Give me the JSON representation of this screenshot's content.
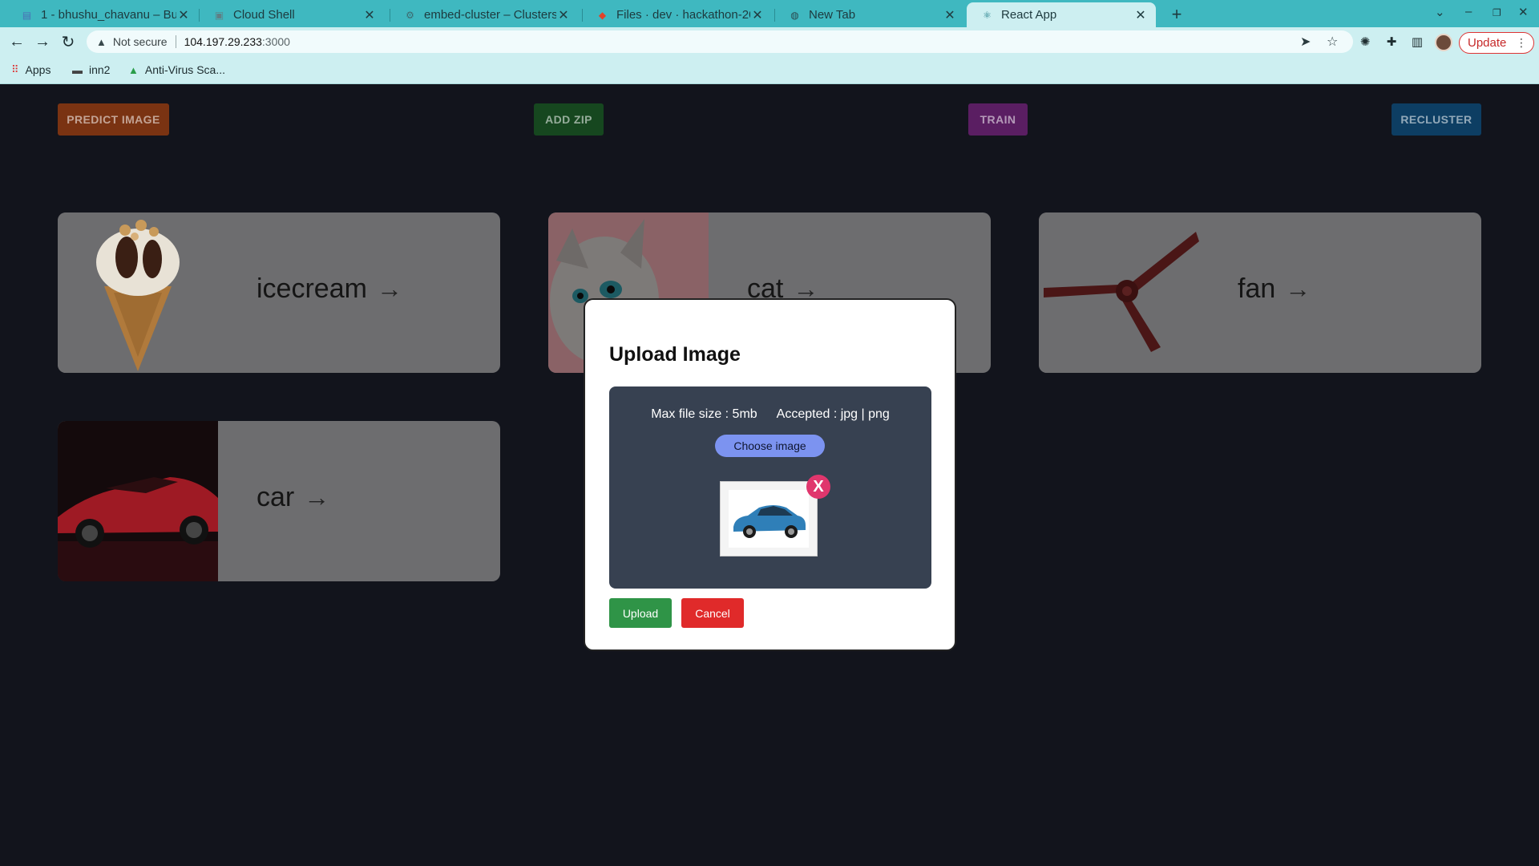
{
  "browser": {
    "tabs": [
      {
        "title": "1 - bhushu_chavanu – Buc",
        "icon": "doc-icon"
      },
      {
        "title": "Cloud Shell",
        "icon": "cloud-icon"
      },
      {
        "title": "embed-cluster – Clusters",
        "icon": "gear-icon"
      },
      {
        "title": "Files · dev · hackathon-20",
        "icon": "gitlab-icon"
      },
      {
        "title": "New Tab",
        "icon": "globe-icon"
      },
      {
        "title": "React App",
        "icon": "react-icon",
        "active": true
      }
    ],
    "address": {
      "security": "Not secure",
      "host": "104.197.29.233",
      "port": ":3000"
    },
    "update_label": "Update",
    "bookmarks": [
      {
        "label": "Apps",
        "icon": "apps-grid-icon"
      },
      {
        "label": "inn2",
        "icon": "folder-icon"
      },
      {
        "label": "Anti-Virus Sca...",
        "icon": "drive-icon"
      }
    ]
  },
  "actions": {
    "predict": "PREDICT IMAGE",
    "add_zip": "ADD ZIP",
    "train": "TRAIN",
    "recluster": "RECLUSTER",
    "colors": {
      "predict": "#7a3312",
      "add_zip": "#16471f",
      "train": "#5a1e62",
      "recluster": "#0d3e63"
    }
  },
  "clusters": [
    {
      "label": "icecream",
      "image": "icecream-cone"
    },
    {
      "label": "cat",
      "image": "kitten"
    },
    {
      "label": "fan",
      "image": "ceiling-fan"
    },
    {
      "label": "car",
      "image": "red-sports-car"
    }
  ],
  "modal": {
    "title": "Upload Image",
    "max_size": "Max file size : 5mb",
    "accepted": "Accepted : jpg | png",
    "choose_label": "Choose image",
    "remove_label": "X",
    "upload_label": "Upload",
    "cancel_label": "Cancel",
    "preview_image": "blue-sedan"
  }
}
